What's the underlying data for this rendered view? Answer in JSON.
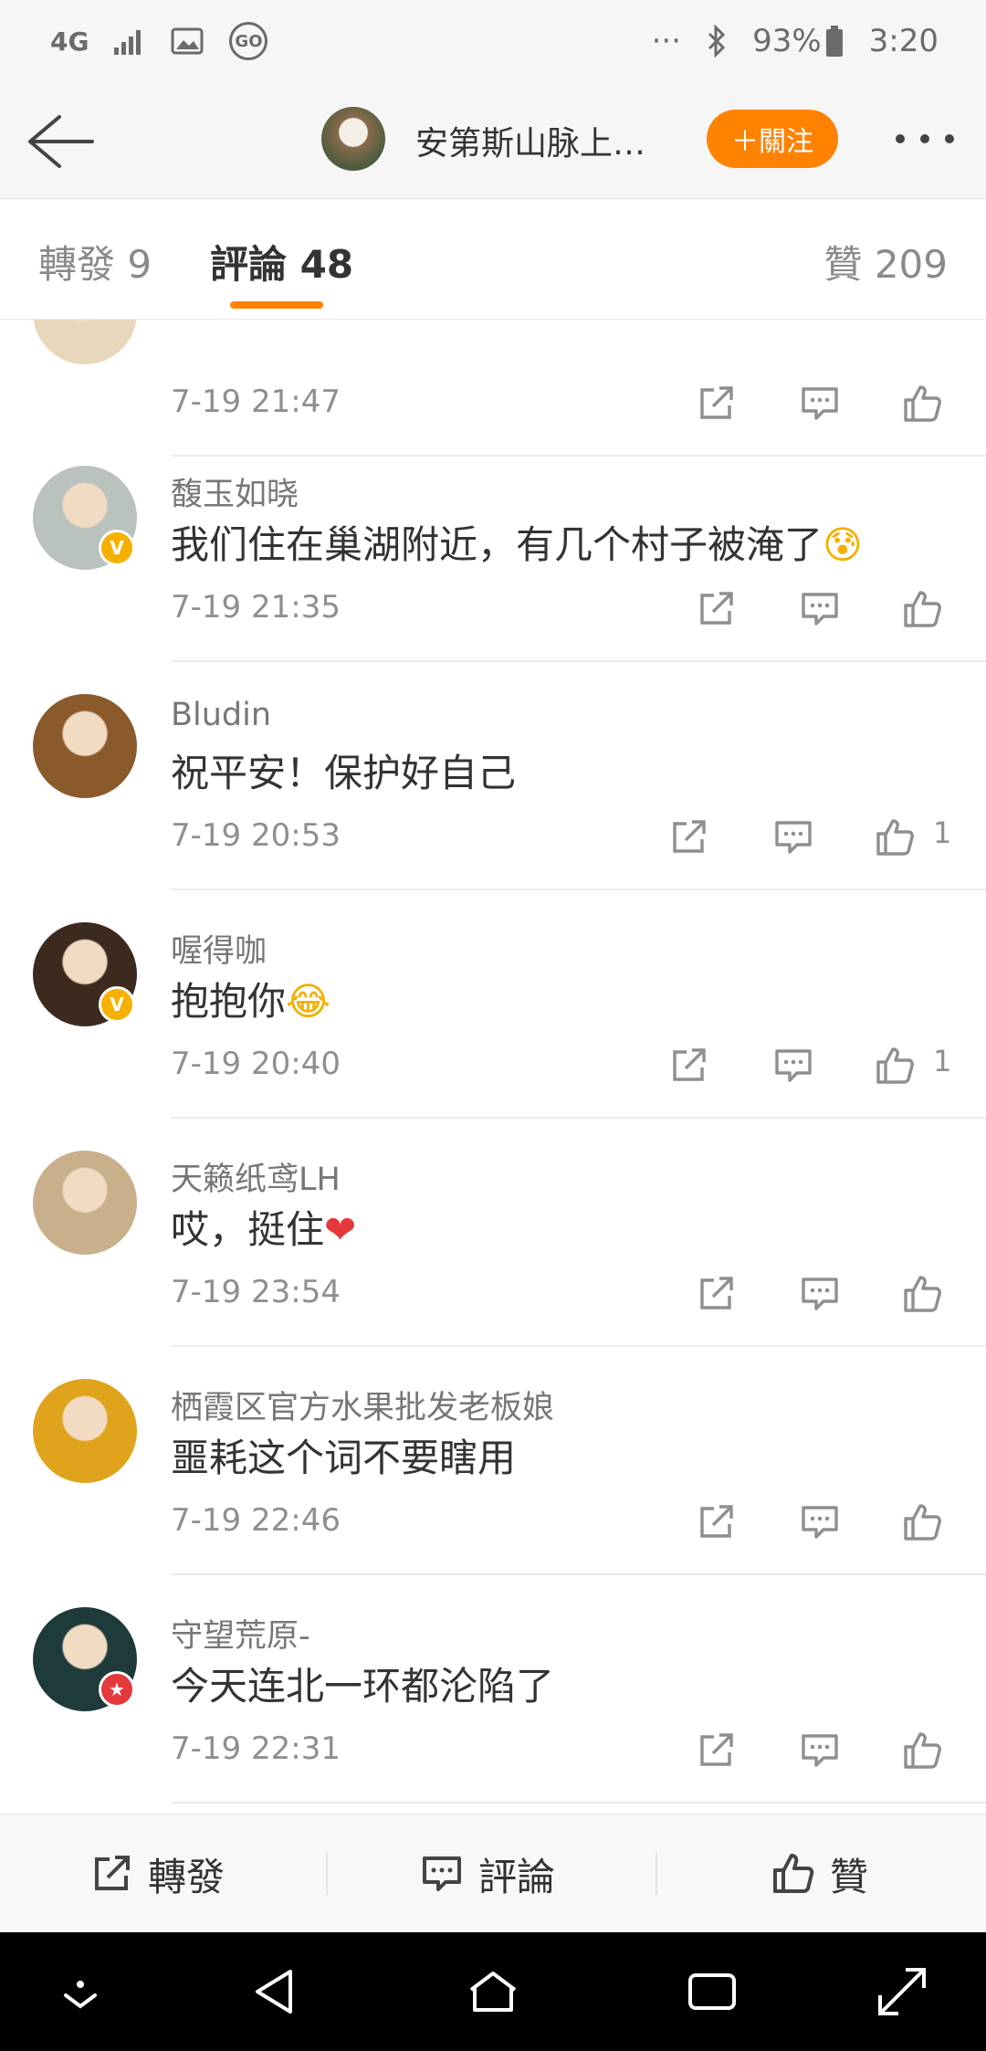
{
  "status_bar": {
    "network": "4G",
    "battery": "93%",
    "time": "3:20",
    "more": "···",
    "go_label": "GO"
  },
  "header": {
    "title": "安第斯山脉上…",
    "follow_label": "＋關注"
  },
  "tabs": {
    "repost": "轉發 9",
    "comment": "評論 48",
    "like": "贊 209",
    "active": "comment"
  },
  "comments": [
    {
      "name": "",
      "text": "",
      "time": "7-19 21:47",
      "likes": "",
      "avatar": "#e9d7bd",
      "badge": ""
    },
    {
      "name": "馥玉如晓",
      "text": "我们住在巢湖附近，有几个村子被淹了",
      "emoji": "😰",
      "time": "7-19 21:35",
      "likes": "",
      "avatar": "#b9c2bd",
      "badge": "V"
    },
    {
      "name": "Bludin",
      "text": "祝平安！保护好自己",
      "emoji": "",
      "time": "7-19 20:53",
      "likes": "1",
      "avatar": "#8a5a2c",
      "badge": ""
    },
    {
      "name": "喔得咖",
      "text": "抱抱你",
      "emoji": "😂",
      "time": "7-19 20:40",
      "likes": "1",
      "avatar": "#3c2a1f",
      "badge": "V"
    },
    {
      "name": "天籁纸鸢LH",
      "text": "哎，挺住",
      "emoji": "❤",
      "time": "7-19 23:54",
      "likes": "",
      "avatar": "#c7b08a",
      "badge": ""
    },
    {
      "name": "栖霞区官方水果批发老板娘",
      "text": "噩耗这个词不要瞎用",
      "emoji": "",
      "time": "7-19 22:46",
      "likes": "",
      "avatar": "#e0a31c",
      "badge": ""
    },
    {
      "name": "守望荒原-",
      "text": "今天连北一环都沦陷了",
      "emoji": "",
      "time": "7-19 22:31",
      "likes": "",
      "avatar": "#1f3a3a",
      "badge": "★"
    }
  ],
  "bottom_bar": {
    "repost": "轉發",
    "comment": "評論",
    "like": "贊"
  },
  "colors": {
    "accent": "#ff8200",
    "text": "#333333",
    "muted": "#8f8f8f",
    "verified": "#f6b100",
    "red_badge": "#e4393c"
  }
}
